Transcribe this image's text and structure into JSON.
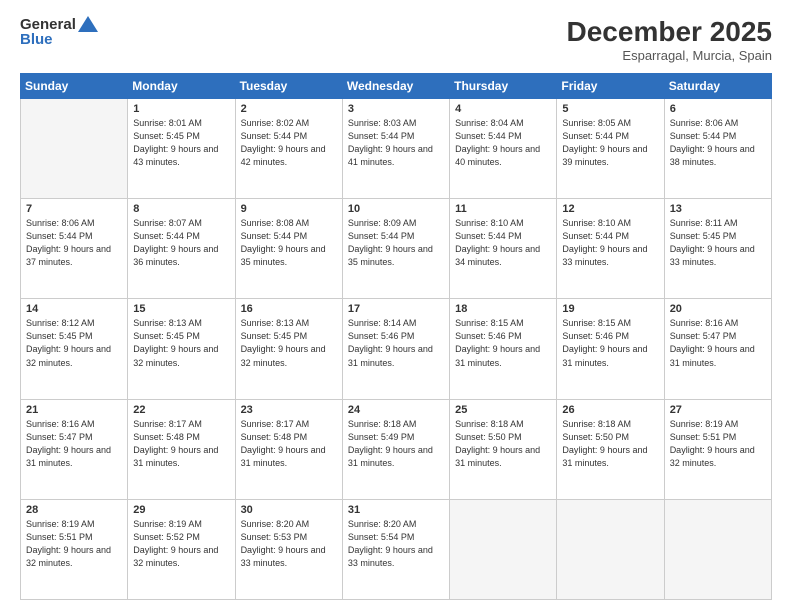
{
  "header": {
    "logo_general": "General",
    "logo_blue": "Blue",
    "month_title": "December 2025",
    "location": "Esparragal, Murcia, Spain"
  },
  "days_of_week": [
    "Sunday",
    "Monday",
    "Tuesday",
    "Wednesday",
    "Thursday",
    "Friday",
    "Saturday"
  ],
  "weeks": [
    [
      {
        "day": "",
        "info": ""
      },
      {
        "day": "1",
        "info": "Sunrise: 8:01 AM\nSunset: 5:45 PM\nDaylight: 9 hours\nand 43 minutes."
      },
      {
        "day": "2",
        "info": "Sunrise: 8:02 AM\nSunset: 5:44 PM\nDaylight: 9 hours\nand 42 minutes."
      },
      {
        "day": "3",
        "info": "Sunrise: 8:03 AM\nSunset: 5:44 PM\nDaylight: 9 hours\nand 41 minutes."
      },
      {
        "day": "4",
        "info": "Sunrise: 8:04 AM\nSunset: 5:44 PM\nDaylight: 9 hours\nand 40 minutes."
      },
      {
        "day": "5",
        "info": "Sunrise: 8:05 AM\nSunset: 5:44 PM\nDaylight: 9 hours\nand 39 minutes."
      },
      {
        "day": "6",
        "info": "Sunrise: 8:06 AM\nSunset: 5:44 PM\nDaylight: 9 hours\nand 38 minutes."
      }
    ],
    [
      {
        "day": "7",
        "info": "Sunrise: 8:06 AM\nSunset: 5:44 PM\nDaylight: 9 hours\nand 37 minutes."
      },
      {
        "day": "8",
        "info": "Sunrise: 8:07 AM\nSunset: 5:44 PM\nDaylight: 9 hours\nand 36 minutes."
      },
      {
        "day": "9",
        "info": "Sunrise: 8:08 AM\nSunset: 5:44 PM\nDaylight: 9 hours\nand 35 minutes."
      },
      {
        "day": "10",
        "info": "Sunrise: 8:09 AM\nSunset: 5:44 PM\nDaylight: 9 hours\nand 35 minutes."
      },
      {
        "day": "11",
        "info": "Sunrise: 8:10 AM\nSunset: 5:44 PM\nDaylight: 9 hours\nand 34 minutes."
      },
      {
        "day": "12",
        "info": "Sunrise: 8:10 AM\nSunset: 5:44 PM\nDaylight: 9 hours\nand 33 minutes."
      },
      {
        "day": "13",
        "info": "Sunrise: 8:11 AM\nSunset: 5:45 PM\nDaylight: 9 hours\nand 33 minutes."
      }
    ],
    [
      {
        "day": "14",
        "info": "Sunrise: 8:12 AM\nSunset: 5:45 PM\nDaylight: 9 hours\nand 32 minutes."
      },
      {
        "day": "15",
        "info": "Sunrise: 8:13 AM\nSunset: 5:45 PM\nDaylight: 9 hours\nand 32 minutes."
      },
      {
        "day": "16",
        "info": "Sunrise: 8:13 AM\nSunset: 5:45 PM\nDaylight: 9 hours\nand 32 minutes."
      },
      {
        "day": "17",
        "info": "Sunrise: 8:14 AM\nSunset: 5:46 PM\nDaylight: 9 hours\nand 31 minutes."
      },
      {
        "day": "18",
        "info": "Sunrise: 8:15 AM\nSunset: 5:46 PM\nDaylight: 9 hours\nand 31 minutes."
      },
      {
        "day": "19",
        "info": "Sunrise: 8:15 AM\nSunset: 5:46 PM\nDaylight: 9 hours\nand 31 minutes."
      },
      {
        "day": "20",
        "info": "Sunrise: 8:16 AM\nSunset: 5:47 PM\nDaylight: 9 hours\nand 31 minutes."
      }
    ],
    [
      {
        "day": "21",
        "info": "Sunrise: 8:16 AM\nSunset: 5:47 PM\nDaylight: 9 hours\nand 31 minutes."
      },
      {
        "day": "22",
        "info": "Sunrise: 8:17 AM\nSunset: 5:48 PM\nDaylight: 9 hours\nand 31 minutes."
      },
      {
        "day": "23",
        "info": "Sunrise: 8:17 AM\nSunset: 5:48 PM\nDaylight: 9 hours\nand 31 minutes."
      },
      {
        "day": "24",
        "info": "Sunrise: 8:18 AM\nSunset: 5:49 PM\nDaylight: 9 hours\nand 31 minutes."
      },
      {
        "day": "25",
        "info": "Sunrise: 8:18 AM\nSunset: 5:50 PM\nDaylight: 9 hours\nand 31 minutes."
      },
      {
        "day": "26",
        "info": "Sunrise: 8:18 AM\nSunset: 5:50 PM\nDaylight: 9 hours\nand 31 minutes."
      },
      {
        "day": "27",
        "info": "Sunrise: 8:19 AM\nSunset: 5:51 PM\nDaylight: 9 hours\nand 32 minutes."
      }
    ],
    [
      {
        "day": "28",
        "info": "Sunrise: 8:19 AM\nSunset: 5:51 PM\nDaylight: 9 hours\nand 32 minutes."
      },
      {
        "day": "29",
        "info": "Sunrise: 8:19 AM\nSunset: 5:52 PM\nDaylight: 9 hours\nand 32 minutes."
      },
      {
        "day": "30",
        "info": "Sunrise: 8:20 AM\nSunset: 5:53 PM\nDaylight: 9 hours\nand 33 minutes."
      },
      {
        "day": "31",
        "info": "Sunrise: 8:20 AM\nSunset: 5:54 PM\nDaylight: 9 hours\nand 33 minutes."
      },
      {
        "day": "",
        "info": ""
      },
      {
        "day": "",
        "info": ""
      },
      {
        "day": "",
        "info": ""
      }
    ]
  ]
}
